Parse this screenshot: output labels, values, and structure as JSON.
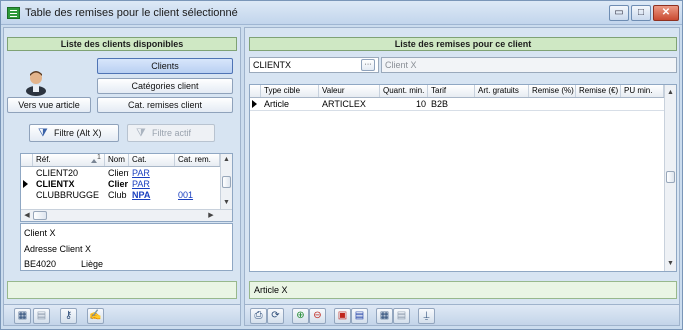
{
  "window": {
    "title": "Table des remises pour le client sélectionné",
    "controls": {
      "minimize": "▭",
      "maximize": "□",
      "close": "✕"
    }
  },
  "left": {
    "header": "Liste des clients disponibles",
    "buttons": {
      "clients": "Clients",
      "categories": "Catégories client",
      "vers_vue_article": "Vers vue article",
      "cat_remises": "Cat. remises client",
      "filtre": "Filtre (Alt X)",
      "filtre_actif": "Filtre actif"
    },
    "columns": [
      "Réf.",
      "Nom",
      "Cat.",
      "Cat. rem."
    ],
    "sort_indicator": "1",
    "rows": [
      {
        "ref": "CLIENT20",
        "nom": "Client",
        "cat": "PAR",
        "cat_rem": ""
      },
      {
        "ref": "CLIENTX",
        "nom": "Clier",
        "cat": "PAR",
        "cat_rem": ""
      },
      {
        "ref": "CLUBBRUGGE",
        "nom": "Club",
        "cat": "NPA",
        "cat_rem": "001"
      }
    ],
    "details": {
      "name": "Client X",
      "address": "Adresse Client X",
      "postcode": "BE4020",
      "city": "Liège"
    },
    "status": ""
  },
  "right": {
    "header": "Liste des remises pour ce client",
    "client_code": "CLIENTX",
    "lookup_button": "···",
    "client_name": "Client X",
    "columns": [
      "Type cible",
      "Valeur",
      "Quant. min.",
      "Tarif",
      "Art. gratuits",
      "Remise (%)",
      "Remise (€)",
      "PU min."
    ],
    "rows": [
      {
        "type_cible": "Article",
        "valeur": "ARTICLEX",
        "quant_min": "10",
        "tarif": "B2B",
        "art_gratuits": "",
        "remise_pct": "",
        "remise_eur": "",
        "pu_min": ""
      }
    ],
    "status": "Article X"
  },
  "icons": {
    "left_toolbar": [
      "grid-view-icon",
      "grid-alt-icon",
      "key-icon",
      "signature-icon"
    ],
    "right_toolbar": [
      "print-icon",
      "refresh-icon",
      "add-icon",
      "delete-icon",
      "form-view-icon",
      "list-view-icon",
      "grid-view-icon",
      "grid-alt-icon",
      "pin-icon"
    ]
  }
}
